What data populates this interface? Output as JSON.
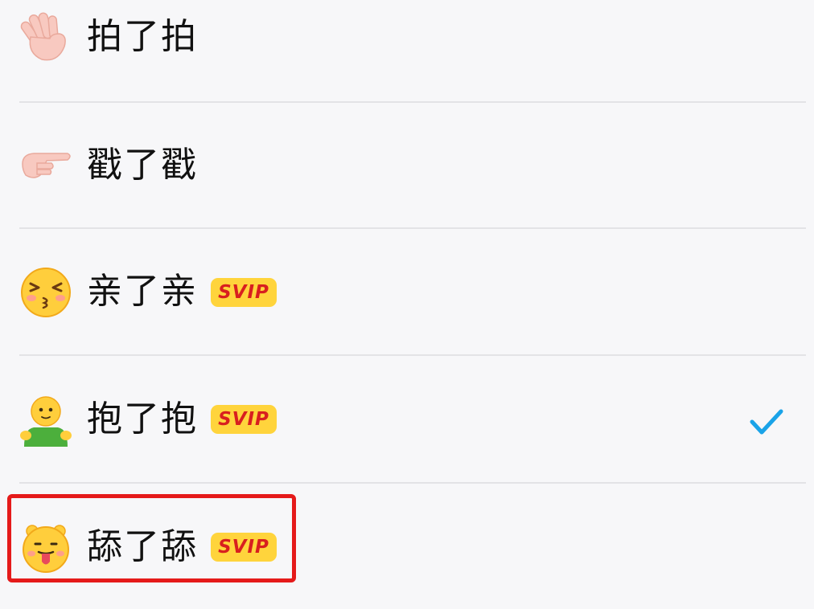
{
  "options": [
    {
      "icon": "wave-hand-icon",
      "label": "拍了拍",
      "badge": "",
      "selected": false
    },
    {
      "icon": "pointing-finger-icon",
      "label": "戳了戳",
      "badge": "",
      "selected": false
    },
    {
      "icon": "kiss-face-icon",
      "label": "亲了亲",
      "badge": "SVIP",
      "selected": false
    },
    {
      "icon": "hug-person-icon",
      "label": "抱了抱",
      "badge": "SVIP",
      "selected": true
    },
    {
      "icon": "tongue-face-icon",
      "label": "舔了舔",
      "badge": "SVIP",
      "selected": false
    }
  ],
  "colors": {
    "accent_check": "#1aa3e8",
    "badge_bg": "#ffd43c",
    "badge_text": "#d81f1f",
    "highlight": "#e51a1a"
  }
}
